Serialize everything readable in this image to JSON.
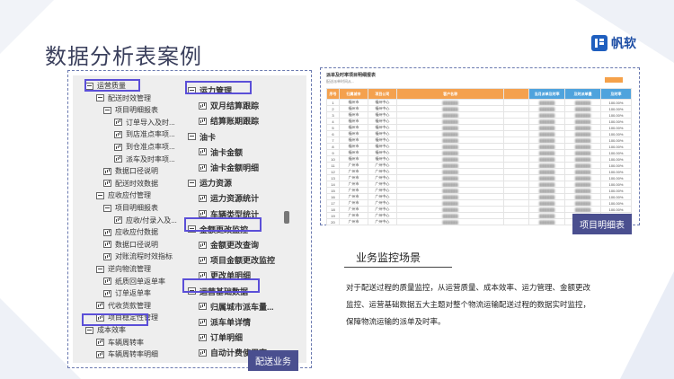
{
  "page": {
    "title": "数据分析表案例",
    "brand": "帆软"
  },
  "tree": {
    "col1": [
      {
        "label": "运营质量",
        "icon": "minus"
      },
      {
        "label": "配送时效管理",
        "icon": "minus"
      },
      {
        "label": "项目明细报表",
        "icon": "minus"
      },
      {
        "label": "订单导入及时...",
        "icon": "chart"
      },
      {
        "label": "到店准点率项...",
        "icon": "chart"
      },
      {
        "label": "到仓准点率项...",
        "icon": "chart"
      },
      {
        "label": "派车及时率项...",
        "icon": "chart"
      },
      {
        "label": "数据口径说明",
        "icon": "chart"
      },
      {
        "label": "配送时效数据",
        "icon": "chart"
      },
      {
        "label": "应收应付管理",
        "icon": "minus"
      },
      {
        "label": "项目明细报表",
        "icon": "minus"
      },
      {
        "label": "应收/付录入及...",
        "icon": "chart"
      },
      {
        "label": "应收应付数据",
        "icon": "chart"
      },
      {
        "label": "数据口径说明",
        "icon": "chart"
      },
      {
        "label": "对账流程时效指标",
        "icon": "chart"
      },
      {
        "label": "逆向物流管理",
        "icon": "minus"
      },
      {
        "label": "纸质回单返单率",
        "icon": "chart"
      },
      {
        "label": "订单返单率",
        "icon": "chart"
      },
      {
        "label": "代收货款管理",
        "icon": "chart"
      },
      {
        "label": "项目稳定性管理",
        "icon": "chart"
      },
      {
        "label": "成本效率",
        "icon": "minus"
      },
      {
        "label": "车辆周转率",
        "icon": "chart"
      },
      {
        "label": "车辆周转率明细",
        "icon": "chart"
      }
    ],
    "col2": [
      {
        "label": "运力管理",
        "icon": "minus"
      },
      {
        "label": "双月结算跟踪",
        "icon": "chart"
      },
      {
        "label": "结算账期跟踪",
        "icon": "chart"
      },
      {
        "label": "油卡",
        "icon": "minus"
      },
      {
        "label": "油卡金额",
        "icon": "chart"
      },
      {
        "label": "油卡金额明细",
        "icon": "chart"
      },
      {
        "label": "运力资源",
        "icon": "minus"
      },
      {
        "label": "运力资源统计",
        "icon": "chart"
      },
      {
        "label": "车辆类型统计",
        "icon": "chart"
      },
      {
        "label": "金额更改监控",
        "icon": "minus"
      },
      {
        "label": "金额更改查询",
        "icon": "chart"
      },
      {
        "label": "项目金额更改监控",
        "icon": "chart"
      },
      {
        "label": "更改单明细",
        "icon": "chart"
      },
      {
        "label": "运营基础数据",
        "icon": "minus"
      },
      {
        "label": "归属城市派车量...",
        "icon": "chart"
      },
      {
        "label": "派车单详情",
        "icon": "chart"
      },
      {
        "label": "订单明细",
        "icon": "chart"
      },
      {
        "label": "自动计费使用率",
        "icon": "chart"
      }
    ]
  },
  "tags": {
    "left": "配送业务",
    "right": "项目明细表"
  },
  "table": {
    "title": "派单及时率项目明细报表",
    "subtitle": "配送派单时间从...",
    "headers": [
      "序号",
      "归属城市",
      "项目公司",
      "客户名称",
      "",
      "当月派单及时率",
      "",
      ""
    ],
    "subheaders": [
      "",
      "",
      "",
      "",
      "",
      "派单量",
      "及时派单量",
      "及时率"
    ],
    "rows": [
      [
        "1",
        "福州市",
        "福州中心",
        "",
        "",
        "",
        "",
        "100.00%"
      ],
      [
        "2",
        "福州市",
        "福州中心",
        "",
        "",
        "",
        "",
        "100.00%"
      ],
      [
        "3",
        "福州市",
        "福州中心",
        "",
        "",
        "",
        "",
        "100.00%"
      ],
      [
        "4",
        "福州市",
        "福州中心",
        "",
        "",
        "",
        "",
        "100.00%"
      ],
      [
        "5",
        "福州市",
        "福州中心",
        "",
        "",
        "",
        "",
        "100.00%"
      ],
      [
        "6",
        "福州市",
        "福州中心",
        "",
        "",
        "",
        "",
        "100.00%"
      ],
      [
        "7",
        "福州市",
        "福州中心",
        "",
        "",
        "",
        "",
        "100.00%"
      ],
      [
        "8",
        "福州市",
        "福州中心",
        "",
        "",
        "",
        "",
        "100.00%"
      ],
      [
        "9",
        "福州市",
        "福州中心",
        "",
        "",
        "",
        "",
        "100.00%"
      ],
      [
        "10",
        "福州市",
        "福州中心",
        "",
        "",
        "",
        "",
        "100.00%"
      ],
      [
        "11",
        "广州市",
        "广州中心",
        "",
        "",
        "",
        "",
        "100.00%"
      ],
      [
        "12",
        "广州市",
        "广州中心",
        "",
        "",
        "",
        "",
        "100.00%"
      ],
      [
        "13",
        "广州市",
        "广州中心",
        "",
        "",
        "",
        "",
        "100.00%"
      ],
      [
        "14",
        "广州市",
        "广州中心",
        "",
        "",
        "",
        "",
        "100.00%"
      ],
      [
        "15",
        "广州市",
        "广州中心",
        "",
        "",
        "",
        "",
        "100.00%"
      ],
      [
        "16",
        "广州市",
        "广州中心",
        "",
        "",
        "",
        "",
        "100.00%"
      ],
      [
        "17",
        "广州市",
        "广州中心",
        "",
        "",
        "",
        "",
        "100.00%"
      ],
      [
        "18",
        "广州市",
        "广州中心",
        "",
        "",
        "",
        "",
        "100.00%"
      ],
      [
        "19",
        "广州市",
        "广州中心",
        "",
        "",
        "",
        "",
        "100.00%"
      ],
      [
        "20",
        "广州市",
        "广州中心",
        "",
        "",
        "",
        "",
        "100.00%"
      ]
    ]
  },
  "description": {
    "title": "业务监控场景",
    "text": "对于配送过程的质量监控，从运营质量、成本效率、运力管理、金额更改监控、运营基础数据五大主题对整个物流运输配送过程的数据实时监控，保障物流运输的派单及时率。"
  },
  "colors": {
    "accent": "#5b4fd8",
    "tag": "#4a4f8f",
    "orange": "#f4a14e",
    "blue": "#4fa3dd"
  }
}
